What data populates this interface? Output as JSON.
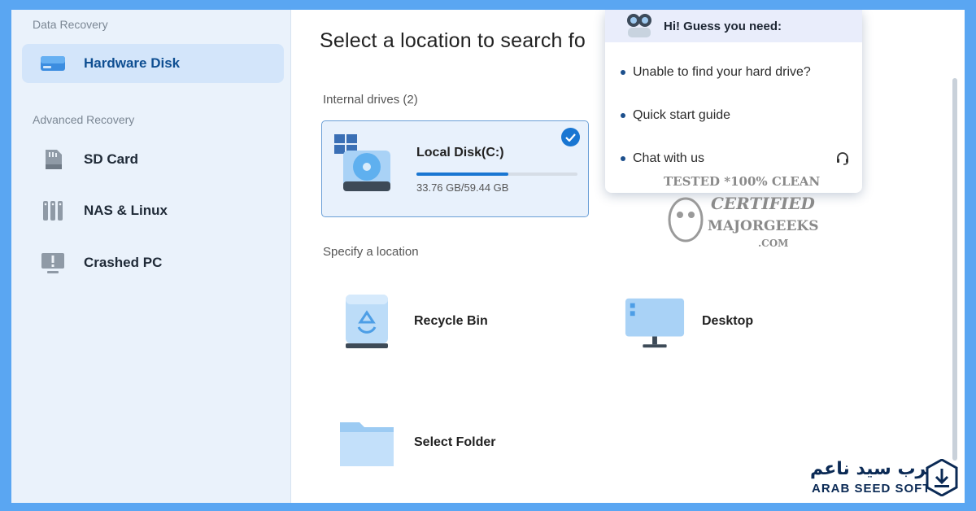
{
  "sidebar": {
    "section_data_recovery": "Data Recovery",
    "section_advanced": "Advanced Recovery",
    "items": [
      {
        "label": "Hardware Disk",
        "icon": "hard-drive-icon",
        "active": true
      },
      {
        "label": "SD Card",
        "icon": "sd-card-icon"
      },
      {
        "label": "NAS & Linux",
        "icon": "nas-icon"
      },
      {
        "label": "Crashed PC",
        "icon": "crashed-pc-icon"
      }
    ]
  },
  "main": {
    "title": "Select a location to search fo",
    "internal_drives_label": "Internal drives (2)",
    "disk": {
      "name": "Local Disk(C:)",
      "size": "33.76 GB/59.44 GB",
      "used_fraction": 0.57,
      "selected": true
    },
    "specify_label": "Specify a location",
    "locations": [
      {
        "label": "Recycle Bin",
        "icon": "recycle-bin-icon"
      },
      {
        "label": "Desktop",
        "icon": "desktop-icon"
      },
      {
        "label": "Select Folder",
        "icon": "folder-icon"
      }
    ]
  },
  "popup": {
    "greeting": "Hi! Guess you need:",
    "items": [
      "Unable to find your hard drive?",
      "Quick start guide",
      "Chat with us"
    ]
  },
  "watermark": {
    "line1": "TESTED *100% CLEAN",
    "line2": "CERTIFIED",
    "line3": "MAJORGEEKS",
    "line4": ".COM"
  },
  "brand": {
    "arabic": "عرب سيد ناعم",
    "latin": "ARAB SEED SOFT"
  },
  "colors": {
    "accent": "#1976d2",
    "frame": "#5aa6f2",
    "sidebar": "#eaf2fb"
  }
}
